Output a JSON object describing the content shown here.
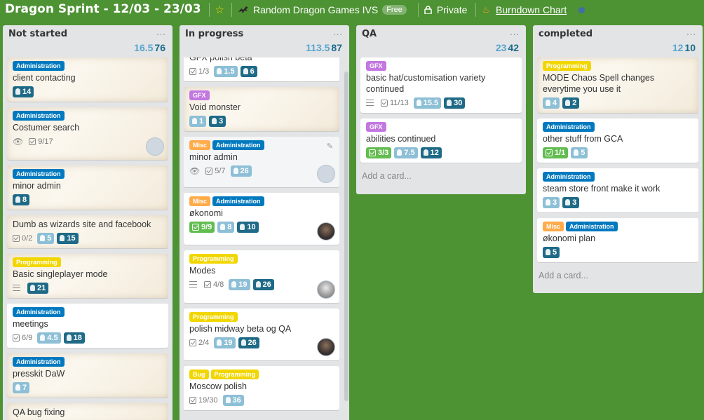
{
  "header": {
    "board_title": "Dragon Sprint - 12/03 - 23/03",
    "team_name": "Random Dragon Games IVS",
    "team_badge": "Free",
    "visibility": "Private",
    "burndown": "Burndown Chart",
    "icons": [
      "star-icon",
      "dragon-icon",
      "lock-icon",
      "flame-icon",
      "globe-icon"
    ]
  },
  "colors": {
    "background": "#4d9233",
    "admin": "#0079bf",
    "gfx": "#c377e0",
    "misc": "#ffab4a",
    "programming": "#f2d600",
    "green_badge": "#61bd4f"
  },
  "lists": [
    {
      "title": "Not started",
      "menu": "...",
      "stat_a": "16.5",
      "stat_b": "76",
      "cards": [
        {
          "labels": [
            {
              "text": "Administration",
              "kind": "admin"
            }
          ],
          "title": "client contacting",
          "badges": {
            "dark": "14"
          }
        },
        {
          "labels": [
            {
              "text": "Administration",
              "kind": "admin"
            }
          ],
          "title": "Costumer search",
          "badges": {
            "check": "9/17"
          }
        },
        {
          "labels": [
            {
              "text": "Administration",
              "kind": "admin"
            }
          ],
          "title": "minor admin",
          "badges": {
            "dark": "8"
          }
        },
        {
          "labels": [],
          "title": "Dumb as wizards site and facebook",
          "badges": {
            "check": "0/2",
            "light": "5",
            "dark": "15"
          }
        },
        {
          "labels": [
            {
              "text": "Programming",
              "kind": "prog"
            }
          ],
          "title": "Basic singleplayer mode",
          "badges": {
            "dark": "21"
          }
        },
        {
          "labels": [
            {
              "text": "Administration",
              "kind": "admin"
            }
          ],
          "title": "meetings",
          "badges": {
            "check": "6/9",
            "light": "4.5",
            "dark": "18"
          }
        },
        {
          "labels": [
            {
              "text": "Administration",
              "kind": "admin"
            }
          ],
          "title": "presskit DaW",
          "badges": {
            "light": "7"
          }
        },
        {
          "labels": [],
          "title": "QA bug fixing",
          "badges": {}
        }
      ]
    },
    {
      "title": "In progress",
      "menu": "...",
      "stat_a": "113.5",
      "stat_b": "87",
      "cards": [
        {
          "labels": [],
          "title": "GFX polish beta",
          "badges": {
            "check": "1/3",
            "light": "1.5",
            "dark": "6"
          }
        },
        {
          "labels": [
            {
              "text": "GFX",
              "kind": "gfx"
            }
          ],
          "title": "Void monster",
          "badges": {
            "light": "1",
            "dark": "3"
          }
        },
        {
          "labels": [
            {
              "text": "Misc",
              "kind": "misc"
            },
            {
              "text": "Administration",
              "kind": "admin"
            }
          ],
          "title": "minor admin",
          "badges": {
            "check": "5/7",
            "light": "26"
          }
        },
        {
          "labels": [
            {
              "text": "Misc",
              "kind": "misc"
            },
            {
              "text": "Administration",
              "kind": "admin"
            }
          ],
          "title": "økonomi",
          "badges": {
            "green": "9/9",
            "light": "8",
            "dark": "10"
          }
        },
        {
          "labels": [
            {
              "text": "Programming",
              "kind": "prog"
            }
          ],
          "title": "Modes",
          "badges": {
            "check": "4/8",
            "light": "19",
            "dark": "26"
          }
        },
        {
          "labels": [
            {
              "text": "Programming",
              "kind": "prog"
            }
          ],
          "title": "polish midway beta og QA",
          "badges": {
            "check": "2/4",
            "light": "19",
            "dark": "26"
          }
        },
        {
          "labels": [
            {
              "text": "Bug",
              "kind": "bug"
            },
            {
              "text": "Programming",
              "kind": "prog"
            }
          ],
          "title": "Moscow polish",
          "badges": {
            "check": "19/30",
            "light": "36"
          }
        }
      ]
    },
    {
      "title": "QA",
      "menu": "...",
      "stat_a": "23",
      "stat_b": "42",
      "cards": [
        {
          "labels": [
            {
              "text": "GFX",
              "kind": "gfx"
            }
          ],
          "title": "basic hat/customisation variety continued",
          "badges": {
            "check": "11/13",
            "light": "15.5",
            "dark": "30"
          }
        },
        {
          "labels": [
            {
              "text": "GFX",
              "kind": "gfx"
            }
          ],
          "title": "abilities continued",
          "badges": {
            "green": "3/3",
            "light": "7.5",
            "dark": "12"
          }
        }
      ],
      "add_card": "Add a card..."
    },
    {
      "title": "completed",
      "menu": "...",
      "stat_a": "12",
      "stat_b": "10",
      "cards": [
        {
          "labels": [
            {
              "text": "Programming",
              "kind": "prog"
            }
          ],
          "title": "MODE Chaos Spell changes everytime you use it",
          "badges": {
            "light": "4",
            "dark": "2"
          }
        },
        {
          "labels": [
            {
              "text": "Administration",
              "kind": "admin"
            }
          ],
          "title": "other stuff from GCA",
          "badges": {
            "green": "1/1",
            "light": "5"
          }
        },
        {
          "labels": [
            {
              "text": "Administration",
              "kind": "admin"
            }
          ],
          "title": "steam store front make it work",
          "badges": {
            "light": "3",
            "dark": "3"
          }
        },
        {
          "labels": [
            {
              "text": "Misc",
              "kind": "misc"
            },
            {
              "text": "Administration",
              "kind": "admin"
            }
          ],
          "title": "økonomi plan",
          "badges": {
            "dark": "5"
          }
        }
      ],
      "add_card": "Add a card..."
    }
  ]
}
